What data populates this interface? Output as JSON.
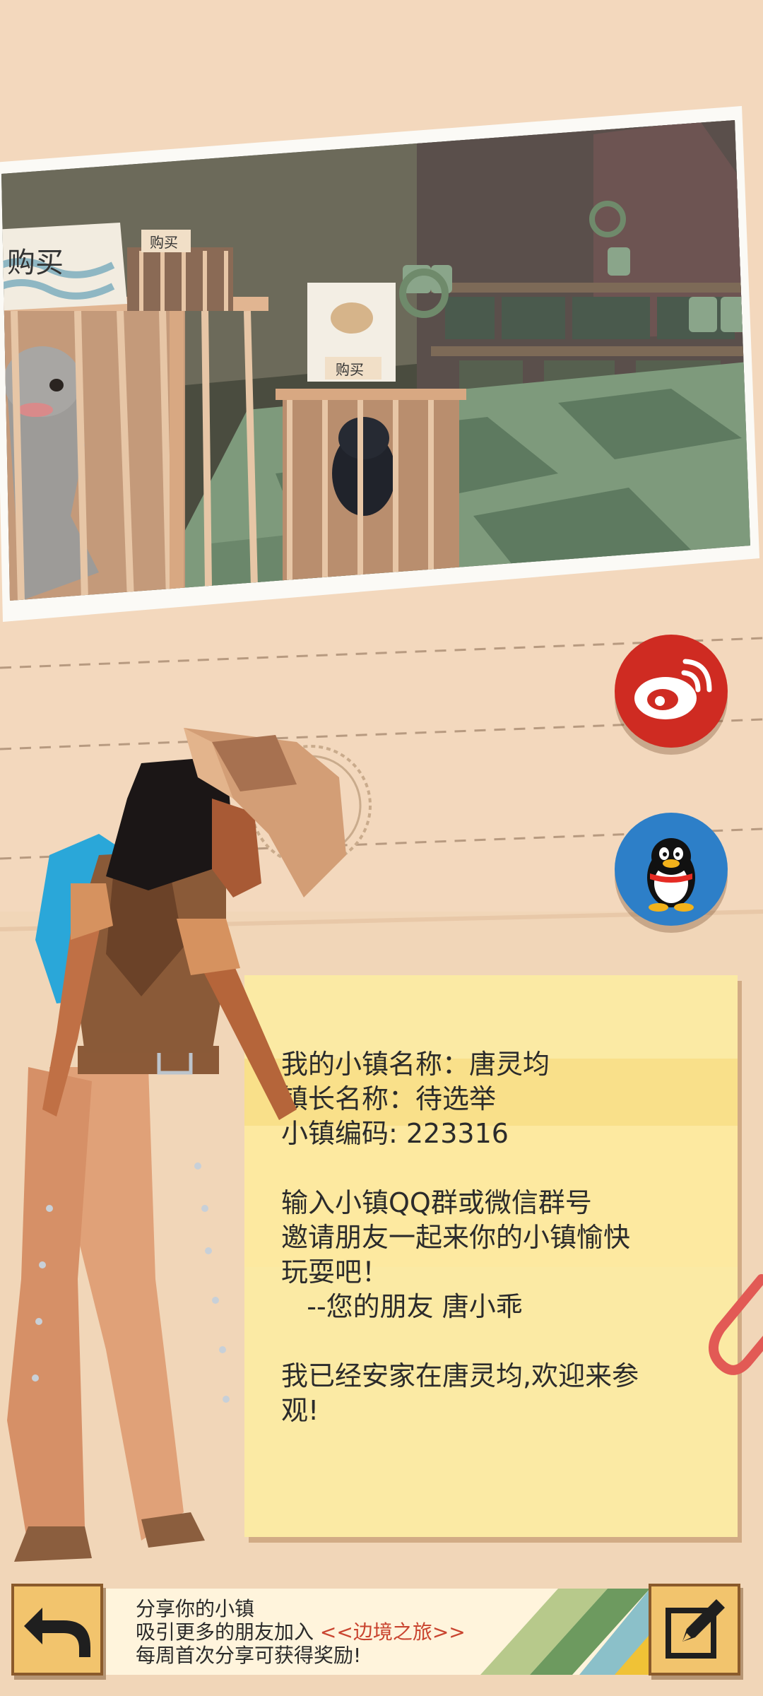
{
  "photo": {
    "sign_buy_large": "购买",
    "sign_buy_small": "购买",
    "sign_buy_dog": "购买"
  },
  "social": {
    "weibo_icon": "weibo-icon",
    "qq_icon": "qq-penguin-icon"
  },
  "note": {
    "town_name_line": "我的小镇名称：唐灵均",
    "mayor_line": "镇长名称：待选举",
    "town_code_line": "小镇编码: 223316",
    "invite_line1": "输入小镇QQ群或微信群号",
    "invite_line2": "邀请朋友一起来你的小镇愉快",
    "invite_line3": "玩耍吧！",
    "signature_line": "   --您的朋友 唐小乖",
    "welcome_line1": "我已经安家在唐灵均,欢迎来参",
    "welcome_line2": "观!"
  },
  "share_banner": {
    "line1": "分享你的小镇",
    "line2_prefix": "吸引更多的朋友加入 ",
    "line2_highlight": "<<边境之旅>>",
    "line3": "每周首次分享可获得奖励!"
  },
  "buttons": {
    "back_icon": "back-arrow-icon",
    "edit_icon": "pencil-edit-icon"
  }
}
